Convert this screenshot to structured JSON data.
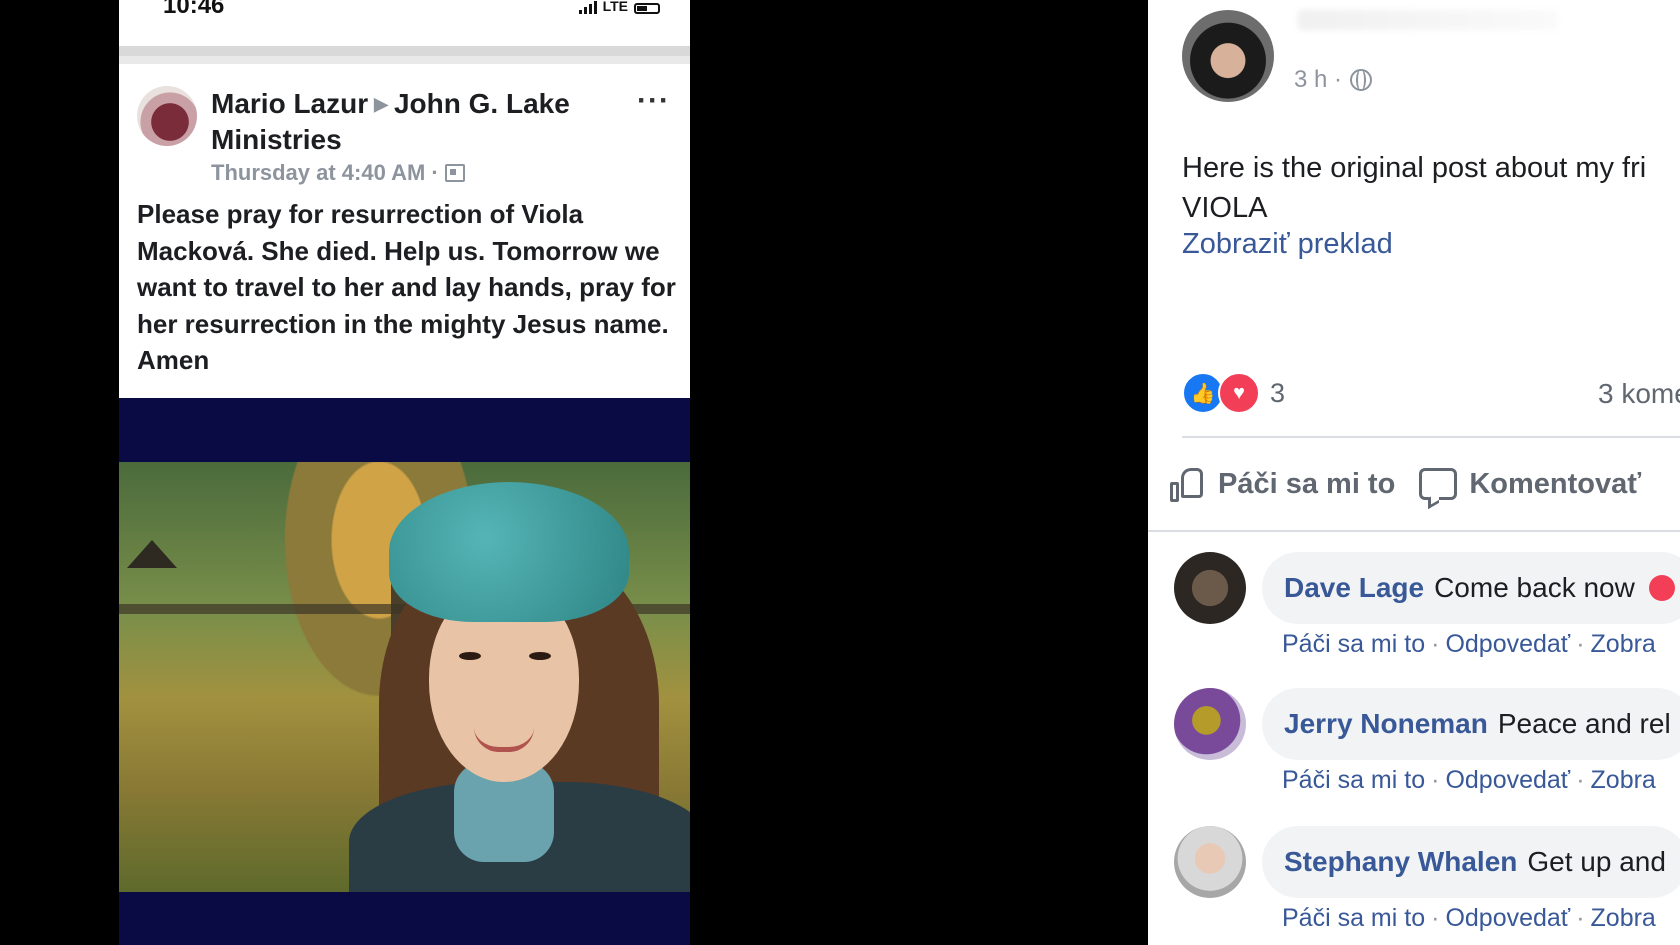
{
  "phone": {
    "status": {
      "time": "10:46",
      "network": "LTE"
    },
    "post": {
      "author": "Mario Lazur",
      "target": "John G. Lake Ministries",
      "timestamp": "Thursday at 4:40 AM",
      "more": "···",
      "text": "Please pray for resurrection of Viola Macková. She died. Help us. Tomorrow we want to travel to her and lay hands, pray for her resurrection in the mighty Jesus name. Amen"
    }
  },
  "fb": {
    "time": "3 h ·",
    "text_line1": "Here is the original post about my fri",
    "text_line2": "VIOLA",
    "translate": "Zobraziť preklad",
    "reaction_count": "3",
    "comments_count": "3 kome",
    "actions": {
      "like": "Páči sa mi to",
      "comment": "Komentovať"
    },
    "comments": [
      {
        "name": "Dave Lage",
        "text": "Come back now",
        "actions": [
          "Páči sa mi to",
          "Odpovedať",
          "Zobra"
        ]
      },
      {
        "name": "Jerry Noneman",
        "text": "Peace and rel",
        "actions": [
          "Páči sa mi to",
          "Odpovedať",
          "Zobra"
        ]
      },
      {
        "name": "Stephany Whalen",
        "text": "Get up and",
        "actions": [
          "Páči sa mi to",
          "Odpovedať",
          "Zobra"
        ]
      }
    ],
    "colors": {
      "link": "#385898",
      "like": "#1877f2",
      "love": "#f33e58"
    }
  }
}
